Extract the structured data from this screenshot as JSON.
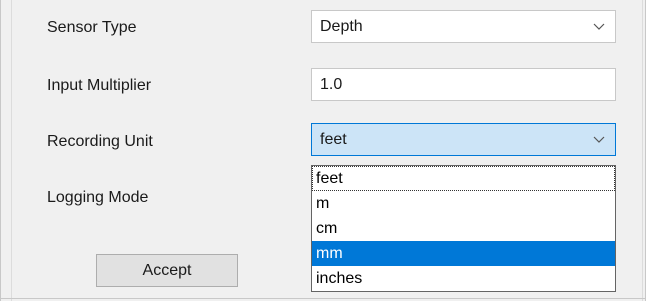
{
  "form": {
    "sensor_type": {
      "label": "Sensor Type",
      "value": "Depth"
    },
    "input_multiplier": {
      "label": "Input Multiplier",
      "value": "1.0"
    },
    "recording_unit": {
      "label": "Recording Unit",
      "value": "feet",
      "options": [
        "feet",
        "m",
        "cm",
        "mm",
        "inches"
      ],
      "highlighted_option": "mm"
    },
    "logging_mode": {
      "label": "Logging Mode"
    }
  },
  "buttons": {
    "accept_label": "Accept"
  },
  "icons": {
    "dropdown": "chevron-down-icon"
  },
  "colors": {
    "highlight": "#0078d7",
    "focus_fill": "#cce4f7"
  }
}
